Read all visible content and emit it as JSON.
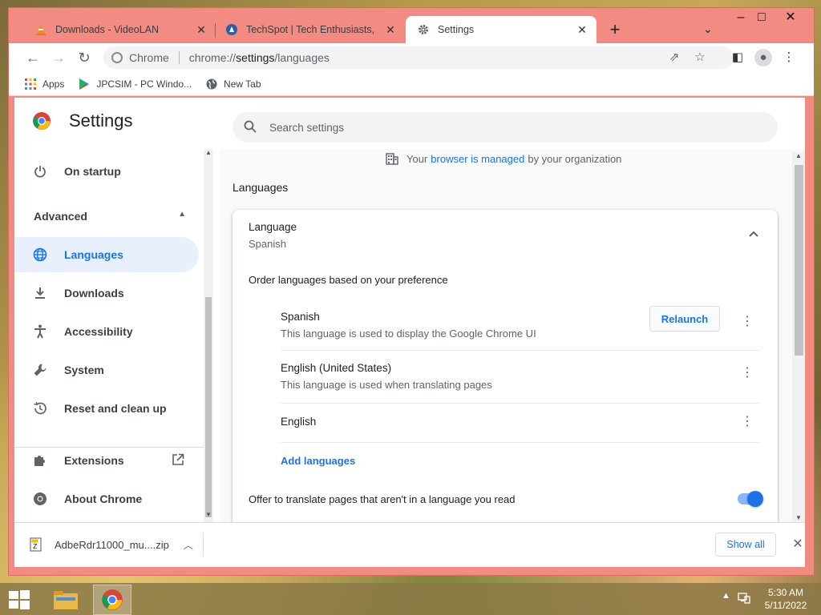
{
  "window": {
    "controls": {
      "minimize": "‒",
      "maximize": "□",
      "close": "✕"
    }
  },
  "tabs": [
    {
      "label": "Downloads - VideoLAN",
      "icon": "vlc-cone-icon",
      "active": false
    },
    {
      "label": "TechSpot | Tech Enthusiasts, Pow",
      "icon": "techspot-icon",
      "active": false
    },
    {
      "label": "Settings",
      "icon": "gear-icon",
      "active": true
    }
  ],
  "tab_close_glyph": "✕",
  "new_tab_glyph": "+",
  "tab_search_glyph": "⌄",
  "toolbar": {
    "back": "←",
    "forward": "→",
    "reload": "↻",
    "site_label": "Chrome",
    "url_prefix": "chrome://",
    "url_host": "settings",
    "url_path": "/languages",
    "share": "⇗",
    "star": "☆",
    "side_panel": "◧",
    "profile": "●",
    "menu": "⋮"
  },
  "bookmarks": [
    {
      "label": "Apps",
      "icon": "apps-grid-icon"
    },
    {
      "label": "JPCSIM - PC Windo...",
      "icon": "play-store-icon"
    },
    {
      "label": "New Tab",
      "icon": "globe-icon"
    }
  ],
  "settings": {
    "title": "Settings",
    "search_placeholder": "Search settings",
    "sidebar": {
      "on_startup": "On startup",
      "advanced": "Advanced",
      "items": [
        {
          "label": "Languages",
          "icon": "globe-icon",
          "active": true
        },
        {
          "label": "Downloads",
          "icon": "download-icon"
        },
        {
          "label": "Accessibility",
          "icon": "accessibility-icon"
        },
        {
          "label": "System",
          "icon": "wrench-icon"
        },
        {
          "label": "Reset and clean up",
          "icon": "history-icon"
        }
      ],
      "extensions": "Extensions",
      "about": "About Chrome"
    },
    "managed": {
      "prefix": "Your",
      "link": "browser is managed",
      "suffix": "by your organization"
    },
    "section_title": "Languages",
    "card": {
      "heading": "Language",
      "current": "Spanish",
      "order_label": "Order languages based on your preference",
      "languages": [
        {
          "name": "Spanish",
          "desc": "This language is used to display the Google Chrome UI",
          "action": "Relaunch"
        },
        {
          "name": "English (United States)",
          "desc": "This language is used when translating pages"
        },
        {
          "name": "English",
          "desc": ""
        }
      ],
      "add_languages": "Add languages",
      "offer_translate": "Offer to translate pages that aren't in a language you read",
      "offer_translate_enabled": true
    }
  },
  "download_shelf": {
    "file": "AdbeRdr11000_mu....zip",
    "show_all": "Show all",
    "close": "✕"
  },
  "taskbar": {
    "time": "5:30 AM",
    "date": "5/11/2022"
  },
  "colors": {
    "accent": "#1a73e8",
    "window_frame": "#f28b82"
  }
}
